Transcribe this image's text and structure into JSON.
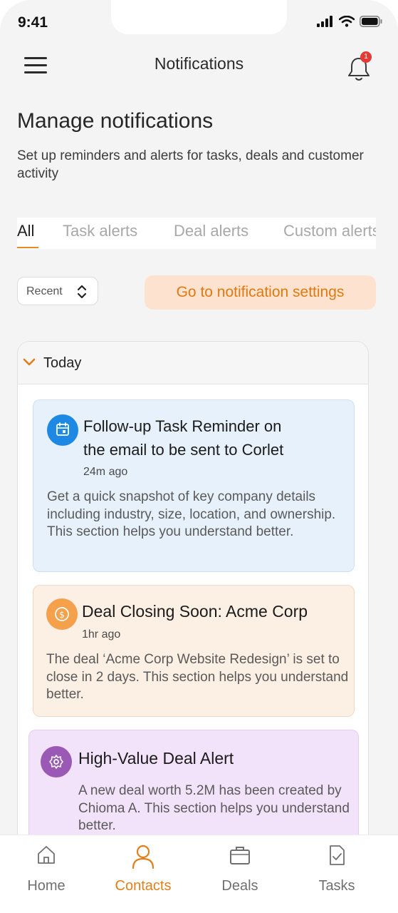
{
  "status_bar": {
    "time": "9:41"
  },
  "header": {
    "title": "Notifications",
    "badge_count": "1"
  },
  "page": {
    "title": "Manage notifications",
    "subtitle": "Set up reminders and alerts for tasks, deals and customer activity"
  },
  "tabs": [
    {
      "label": "All",
      "active": true
    },
    {
      "label": "Task alerts",
      "active": false
    },
    {
      "label": "Deal alerts",
      "active": false
    },
    {
      "label": "Custom alerts",
      "active": false
    }
  ],
  "controls": {
    "sort_value": "Recent",
    "settings_button": "Go to notification settings"
  },
  "group": {
    "label": "Today",
    "notifications": [
      {
        "title_line1": "Follow-up Task Reminder on",
        "title_line2": "the email to be sent to Corlet",
        "time": "24m ago",
        "body": "Get a quick snapshot of key company details including industry, size, location, and ownership. This section helps you understand better.",
        "icon": "calendar-icon",
        "icon_color": "#1e88e5"
      },
      {
        "title": "Deal Closing Soon: Acme Corp",
        "time": "1hr ago",
        "body": "The deal ‘Acme Corp Website Redesign’ is set to close in 2 days. This section helps you understand better.",
        "icon": "dollar-icon",
        "icon_color": "#f5a04a"
      },
      {
        "title": "High-Value Deal Alert",
        "body": "A new deal worth 5.2M has been created by Chioma A. This section helps you understand better.",
        "icon": "gear-icon",
        "icon_color": "#9b59b6"
      }
    ]
  },
  "bottom_nav": [
    {
      "label": "Home",
      "icon": "home-icon",
      "active": false
    },
    {
      "label": "Contacts",
      "icon": "user-icon",
      "active": true
    },
    {
      "label": "Deals",
      "icon": "briefcase-icon",
      "active": false
    },
    {
      "label": "Tasks",
      "icon": "task-icon",
      "active": false
    }
  ],
  "colors": {
    "accent": "#e07a10",
    "accent_bg": "#fde3cf",
    "badge": "#e53935"
  }
}
